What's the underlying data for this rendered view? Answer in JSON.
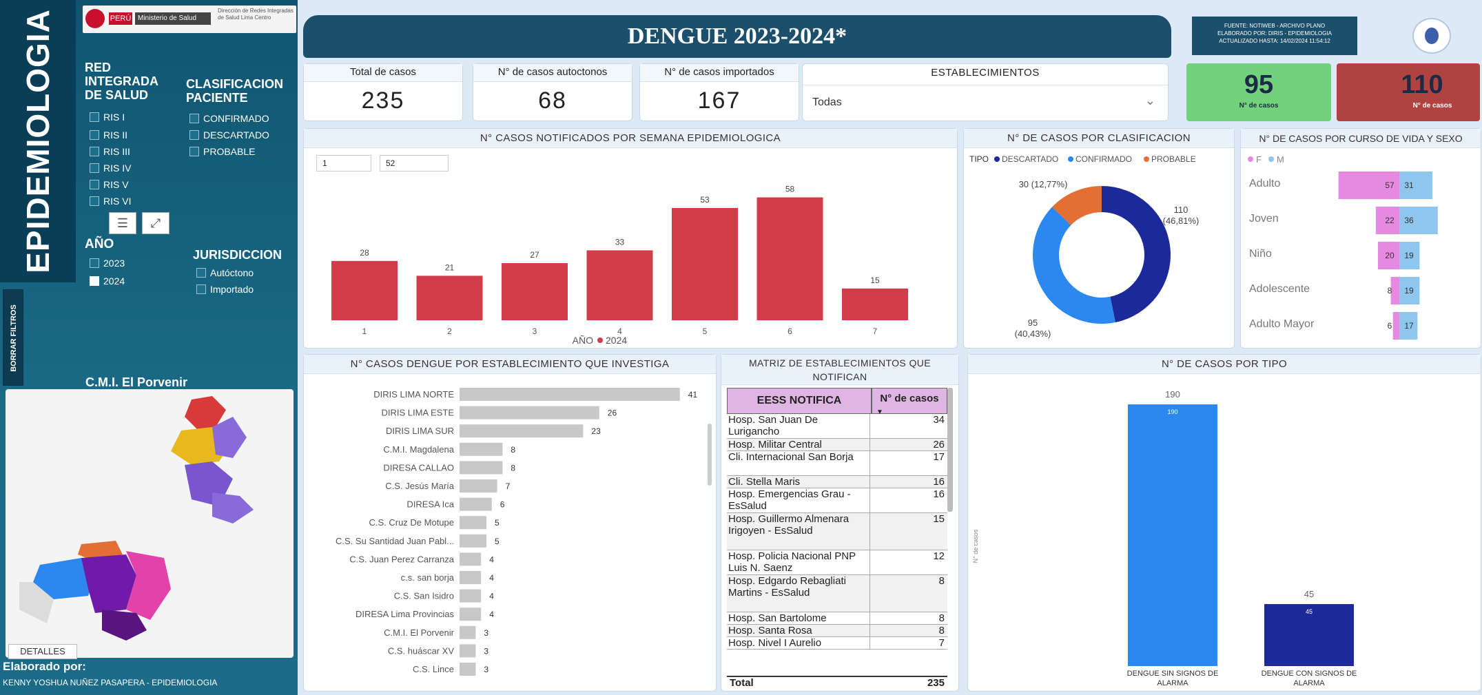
{
  "sidebar": {
    "vertical_title": "EPIDEMIOLOGIA",
    "logo_texts": [
      "PERÚ",
      "Ministerio de Salud",
      "Dirección de Redes Integradas de Salud Lima Centro"
    ],
    "red_title": "RED INTEGRADA DE SALUD",
    "red_items": [
      "RIS I",
      "RIS II",
      "RIS III",
      "RIS IV",
      "RIS V",
      "RIS VI"
    ],
    "clasif_title": "CLASIFICACION PACIENTE",
    "clasif_items": [
      "CONFIRMADO",
      "DESCARTADO",
      "PROBABLE"
    ],
    "year_title": "AÑO",
    "year_items": [
      {
        "label": "2023",
        "checked": false
      },
      {
        "label": "2024",
        "checked": true
      }
    ],
    "juris_title": "JURISDICCION",
    "juris_items": [
      "Autóctono",
      "Importado"
    ],
    "borrar_filtros": "BORRAR FILTROS",
    "map_title": "C.M.I. El Porvenir",
    "detalles": "DETALLES",
    "elaborado": "Elaborado por:",
    "author": "KENNY YOSHUA NUÑEZ PASAPERA - EPIDEMIOLOGIA"
  },
  "header": {
    "title": "DENGUE 2023-2024*",
    "source_lines": [
      "FUENTE: NOTIWEB - ARCHIVO PLANO",
      "ELABORADO POR: DIRIS - EPIDEMIOLOGIA",
      "ACTUALIZADO HASTA: 14/02/2024 11:54:12"
    ]
  },
  "kpis": [
    {
      "label": "Total de casos",
      "value": "235"
    },
    {
      "label": "N° de casos autoctonos",
      "value": "68"
    },
    {
      "label": "N° de casos importados",
      "value": "167"
    }
  ],
  "establecimientos": {
    "label": "ESTABLECIMIENTOS",
    "value": "Todas"
  },
  "status_cards": [
    {
      "value": "95",
      "label": "N° de casos",
      "color": "#72d27c"
    },
    {
      "value": "110",
      "label": "N° de casos",
      "color": "#b0433f"
    }
  ],
  "colors": {
    "bar_red": "#d23d4a",
    "gray_bar": "#c8c8c8",
    "pink": "#e58ae0",
    "light_blue": "#8ec6ee",
    "blue": "#2b88ef",
    "navy": "#1c2999",
    "orange": "#e36f34"
  },
  "chart_data": [
    {
      "type": "bar",
      "title": "N° CASOS NOTIFICADOS POR SEMANA EPIDEMIOLOGICA",
      "categories": [
        "1",
        "2",
        "3",
        "4",
        "5",
        "6",
        "7"
      ],
      "values": [
        28,
        21,
        27,
        33,
        53,
        58,
        15
      ],
      "series": [
        {
          "name": "2024",
          "values": [
            28,
            21,
            27,
            33,
            53,
            58,
            15
          ]
        }
      ],
      "legend_title": "AÑO",
      "range_inputs": [
        "1",
        "52"
      ]
    },
    {
      "type": "pie",
      "title": "N° DE CASOS POR CLASIFICACION",
      "legend_title": "TIPO",
      "slices": [
        {
          "name": "DESCARTADO",
          "value": 110,
          "label": "110 (46,81%)"
        },
        {
          "name": "CONFIRMADO",
          "value": 95,
          "label": "95 (40,43%)"
        },
        {
          "name": "PROBABLE",
          "value": 30,
          "label": "30 (12,77%)"
        }
      ]
    },
    {
      "type": "bar",
      "title": "N° DE CASOS POR CURSO DE VIDA Y SEXO",
      "categories": [
        "Adulto",
        "Joven",
        "Niño",
        "Adolescente",
        "Adulto Mayor"
      ],
      "series": [
        {
          "name": "F",
          "values": [
            57,
            22,
            20,
            8,
            6
          ]
        },
        {
          "name": "M",
          "values": [
            31,
            36,
            19,
            19,
            17
          ]
        }
      ]
    },
    {
      "type": "bar",
      "title": "N° CASOS DENGUE POR ESTABLECIMIENTO QUE INVESTIGA",
      "categories": [
        "DIRIS LIMA NORTE",
        "DIRIS LIMA ESTE",
        "DIRIS LIMA SUR",
        "C.M.I. Magdalena",
        "DIRESA CALLAO",
        "C.S. Jesús María",
        "DIRESA Ica",
        "C.S. Cruz De Motupe",
        "C.S. Su Santidad Juan Pabl...",
        "C.S. Juan Perez Carranza",
        "c.s. san borja",
        "C.S. San Isidro",
        "DIRESA Lima Provincias",
        "C.M.I. El Porvenir",
        "C.S. huáscar XV",
        "C.S. Lince"
      ],
      "values": [
        41,
        26,
        23,
        8,
        8,
        7,
        6,
        5,
        5,
        4,
        4,
        4,
        4,
        3,
        3,
        3
      ]
    },
    {
      "type": "table",
      "title": "MATRIZ DE ESTABLECIMIENTOS QUE NOTIFICAN",
      "columns": [
        "EESS NOTIFICA",
        "N° de casos"
      ],
      "rows": [
        [
          "Hosp. San Juan De Lurigancho",
          "34"
        ],
        [
          "Hosp. Militar Central",
          "26"
        ],
        [
          "Cli. Internacional San Borja",
          "17"
        ],
        [
          "Cli. Stella Maris",
          "16"
        ],
        [
          "Hosp. Emergencias Grau - EsSalud",
          "16"
        ],
        [
          "Hosp. Guillermo Almenara Irigoyen - EsSalud",
          "15"
        ],
        [
          "Hosp. Policia Nacional PNP Luis N. Saenz",
          "12"
        ],
        [
          "Hosp. Edgardo Rebagliati Martins - EsSalud",
          "8"
        ],
        [
          "Hosp. San Bartolome",
          "8"
        ],
        [
          "Hosp. Santa Rosa",
          "8"
        ],
        [
          "Hosp. Nivel I Aurelio",
          "7"
        ]
      ],
      "total": [
        "Total",
        "235"
      ]
    },
    {
      "type": "bar",
      "title": "N° DE CASOS POR TIPO",
      "categories": [
        "DENGUE SIN SIGNOS DE ALARMA",
        "DENGUE CON SIGNOS DE ALARMA"
      ],
      "values": [
        190,
        45
      ],
      "ylabel": "N° de casos"
    }
  ]
}
